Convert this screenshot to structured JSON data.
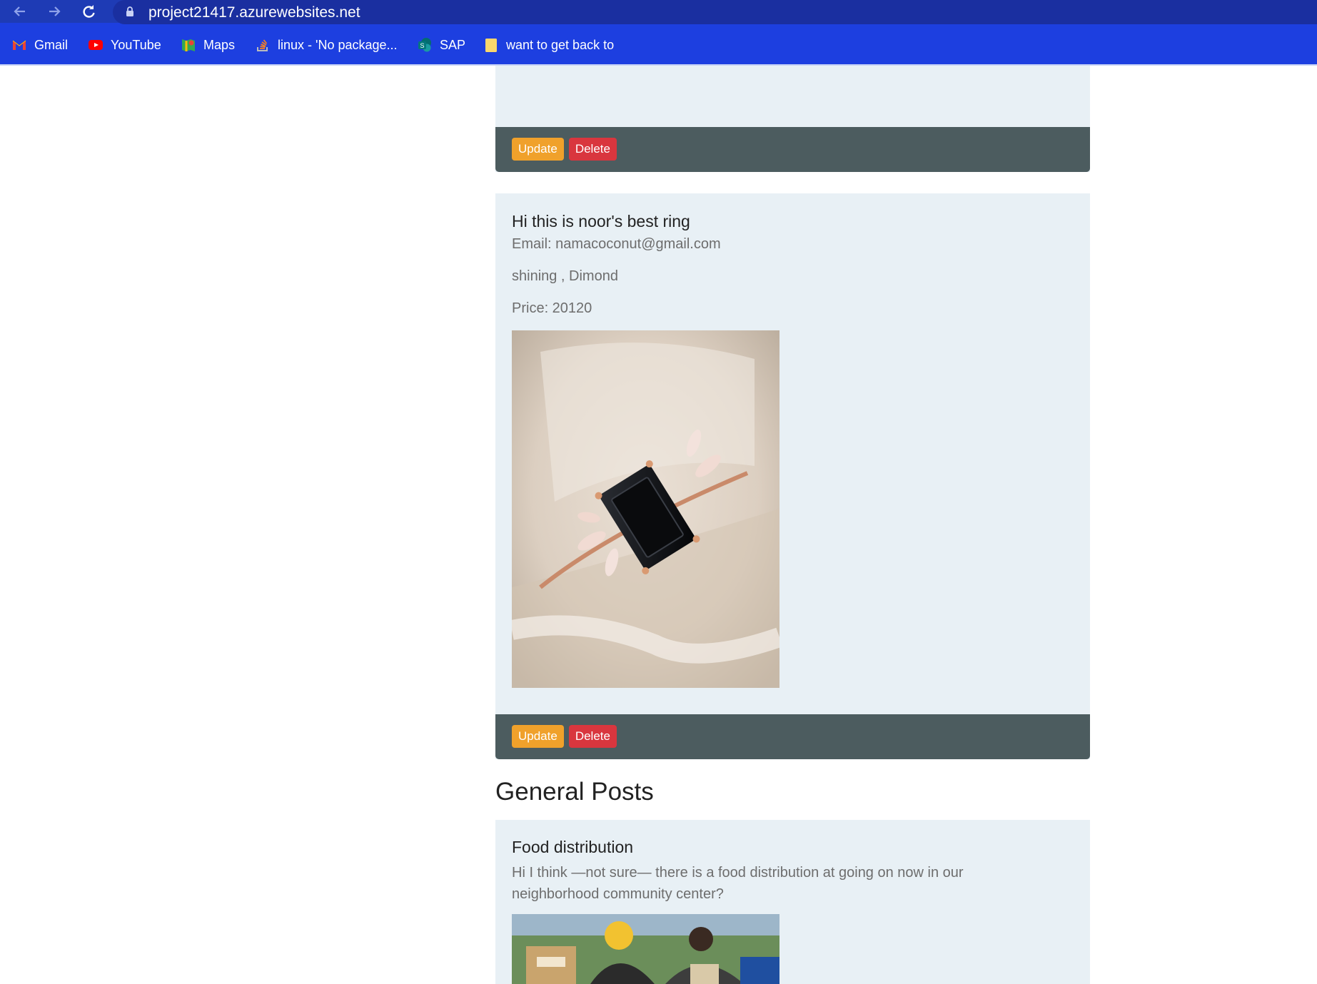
{
  "browser": {
    "url": "project21417.azurewebsites.net",
    "bookmarks": [
      {
        "label": "Gmail",
        "icon": "gmail-icon"
      },
      {
        "label": "YouTube",
        "icon": "youtube-icon"
      },
      {
        "label": "Maps",
        "icon": "maps-icon"
      },
      {
        "label": "linux - 'No package...",
        "icon": "stackoverflow-icon"
      },
      {
        "label": "SAP",
        "icon": "sharepoint-icon"
      },
      {
        "label": "want to get back to",
        "icon": "folder-icon"
      }
    ]
  },
  "posts": [
    {
      "update_label": "Update",
      "delete_label": "Delete"
    },
    {
      "title": "Hi this is noor's best ring",
      "email": "Email: namacoconut@gmail.com",
      "tags": "shining , Dimond",
      "price": "Price: 20120",
      "image": "ring-photo",
      "update_label": "Update",
      "delete_label": "Delete"
    }
  ],
  "general": {
    "heading": "General Posts",
    "posts": [
      {
        "title": "Food distribution",
        "body": "Hi I think —not sure— there is a food distribution at going on now in our neighborhood community center?",
        "image": "food-distribution-photo"
      }
    ]
  },
  "colors": {
    "chrome_blue": "#1d3fe0",
    "card_bg": "#e8f0f5",
    "footer_bg": "#4c5c5f",
    "update": "#f0a12b",
    "delete": "#d9363e"
  }
}
